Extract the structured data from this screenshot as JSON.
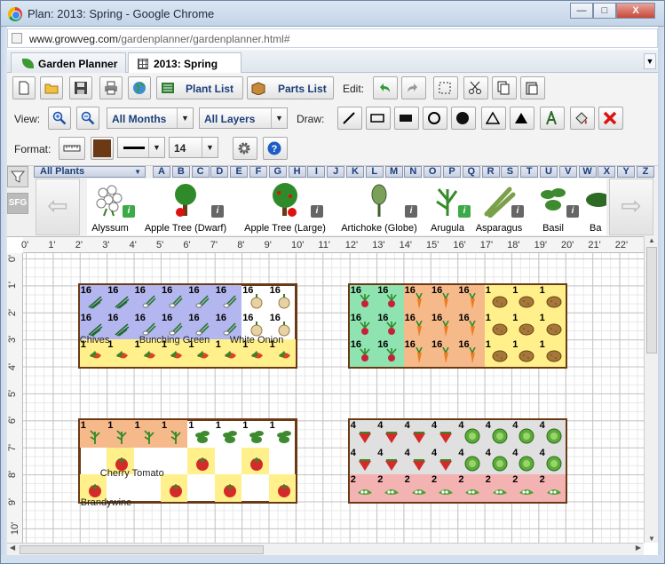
{
  "window": {
    "title": "Plan: 2013: Spring - Google Chrome",
    "min": "—",
    "max": "□",
    "close": "X"
  },
  "address": {
    "host": "www.growveg.com",
    "path": "/gardenplanner/gardenplanner.html#"
  },
  "tabs": [
    {
      "label": "Garden Planner"
    },
    {
      "label": "2013: Spring"
    }
  ],
  "toolbar": {
    "plant_list": "Plant List",
    "parts_list": "Parts List",
    "edit_label": "Edit:",
    "view_label": "View:",
    "months_select": "All Months",
    "layers_select": "All Layers",
    "draw_label": "Draw:",
    "format_label": "Format:",
    "font_size": "14"
  },
  "plant_filter": {
    "select": "All Plants",
    "letters": [
      "A",
      "B",
      "C",
      "D",
      "E",
      "F",
      "G",
      "H",
      "I",
      "J",
      "K",
      "L",
      "M",
      "N",
      "O",
      "P",
      "Q",
      "R",
      "S",
      "T",
      "U",
      "V",
      "W",
      "X",
      "Y",
      "Z"
    ],
    "sfg": "SFG"
  },
  "plants": [
    {
      "name": "Alyssum",
      "info": "green"
    },
    {
      "name": "Apple Tree (Dwarf)",
      "info": "gray"
    },
    {
      "name": "Apple Tree (Large)",
      "info": "gray"
    },
    {
      "name": "Artichoke (Globe)",
      "info": "gray"
    },
    {
      "name": "Arugula",
      "info": "green"
    },
    {
      "name": "Asparagus",
      "info": "gray"
    },
    {
      "name": "Basil",
      "info": "gray"
    },
    {
      "name": "Ba",
      "info": ""
    }
  ],
  "ruler": {
    "h": [
      "0'",
      "1'",
      "2'",
      "3'",
      "4'",
      "5'",
      "6'",
      "7'",
      "8'",
      "9'",
      "10'",
      "11'",
      "12'",
      "13'",
      "14'",
      "15'",
      "16'",
      "17'",
      "18'",
      "19'",
      "20'",
      "21'",
      "22'"
    ],
    "v": [
      "0'",
      "1'",
      "2'",
      "3'",
      "4'",
      "5'",
      "6'",
      "7'",
      "8'",
      "9'",
      "10'"
    ]
  },
  "beds": {
    "bed1": {
      "labels": [
        "Chives",
        "Bunching Green",
        "White Onion"
      ],
      "counts": [
        "16",
        "16",
        "16",
        "16",
        "16",
        "16",
        "16",
        "16",
        "16",
        "16",
        "16",
        "16",
        "16",
        "16",
        "16",
        "16",
        "1",
        "1",
        "1",
        "1",
        "1",
        "1",
        "1",
        "1"
      ]
    },
    "bed2": {
      "counts": [
        "16",
        "16",
        "16",
        "16",
        "16",
        "1",
        "1",
        "1",
        "16",
        "16",
        "16",
        "16",
        "16",
        "1",
        "1",
        "1",
        "16",
        "16",
        "16",
        "16",
        "16",
        "1",
        "1",
        "1"
      ]
    },
    "bed3": {
      "labels": [
        "Cherry Tomato",
        "Brandywine"
      ],
      "counts": [
        "1",
        "1",
        "1",
        "1",
        "1",
        "1",
        "1",
        "1"
      ]
    },
    "bed4": {
      "counts": [
        "4",
        "4",
        "4",
        "4",
        "4",
        "4",
        "4",
        "4",
        "4",
        "4",
        "4",
        "4",
        "4",
        "4",
        "4",
        "4",
        "2",
        "2",
        "2",
        "2",
        "2",
        "2",
        "2",
        "2"
      ]
    }
  },
  "colors": {
    "bed_border": "#6b3a14",
    "chives_bg": "#b3b6ef",
    "pepper_bg": "#fff08c",
    "radish_bg": "#8ee3b0",
    "carrot_bg": "#f6b98a",
    "potato_bg": "#fff08c",
    "tomato_bg": "#fff08c",
    "strawberry_bg": "#e0e0e0",
    "lettuce_bg": "#e0e0e0",
    "pea_bg": "#f4b3b3"
  }
}
